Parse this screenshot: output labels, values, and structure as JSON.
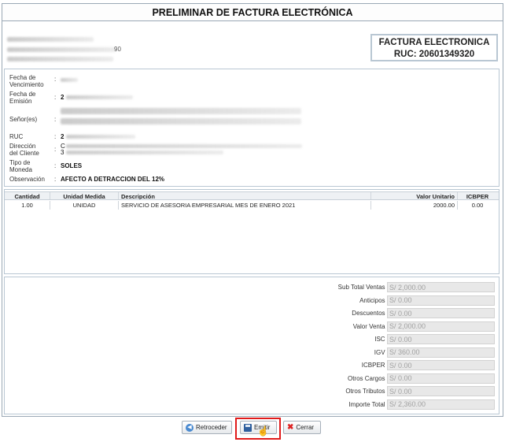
{
  "title": "PRELIMINAR DE FACTURA ELECTRÓNICA",
  "document": {
    "type": "FACTURA ELECTRONICA",
    "ruc_line": "RUC: 20601349320"
  },
  "emitter": {
    "partial_text": "90"
  },
  "client": {
    "vencimiento": {
      "label": "Fecha de Vencimiento",
      "value": ""
    },
    "emision": {
      "label": "Fecha de Emisión",
      "value": "2"
    },
    "senor": {
      "label": "Señor(es)",
      "value": ""
    },
    "ruc": {
      "label": "RUC",
      "value": "2"
    },
    "direccion": {
      "label": "Dirección del Cliente",
      "value": "C",
      "value2": "3"
    },
    "moneda": {
      "label": "Tipo de Moneda",
      "value": "SOLES"
    },
    "observacion": {
      "label": "Observación",
      "value": "AFECTO A DETRACCION DEL 12%"
    }
  },
  "items": {
    "headers": [
      "Cantidad",
      "Unidad Medida",
      "Descripción",
      "Valor Unitario",
      "ICBPER"
    ],
    "rows": [
      [
        "1.00",
        "UNIDAD",
        "SERVICIO DE ASESORIA EMPRESARIAL MES DE ENERO 2021",
        "2000.00",
        "0.00"
      ]
    ]
  },
  "totals": [
    {
      "label": "Sub Total Ventas :",
      "value": "S/ 2,000.00"
    },
    {
      "label": "Anticipos :",
      "value": "S/ 0.00"
    },
    {
      "label": "Descuentos :",
      "value": "S/ 0.00"
    },
    {
      "label": "Valor Venta :",
      "value": "S/ 2,000.00"
    },
    {
      "label": "ISC :",
      "value": "S/ 0.00"
    },
    {
      "label": "IGV :",
      "value": "S/ 360.00"
    },
    {
      "label": "ICBPER :",
      "value": "S/ 0.00"
    },
    {
      "label": "Otros Cargos :",
      "value": "S/ 0.00"
    },
    {
      "label": "Otros Tributos :",
      "value": "S/ 0.00"
    },
    {
      "label": "Importe Total :",
      "value": "S/ 2,360.00"
    }
  ],
  "buttons": {
    "back": "Retroceder",
    "emit": "Emitir",
    "close": "Cerrar"
  },
  "colors": {
    "highlight": "#e01b1b",
    "border": "#9aa8b5"
  }
}
